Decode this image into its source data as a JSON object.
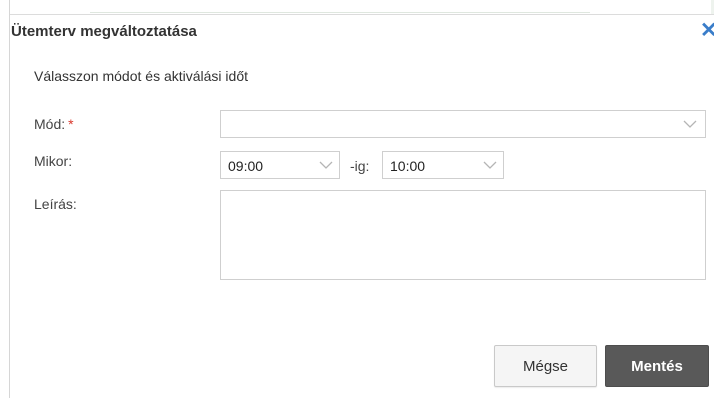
{
  "dialog": {
    "title": "Ütemterv megváltoztatása",
    "instruction": "Válasszon módot és aktiválási időt"
  },
  "form": {
    "mode_label": "Mód:",
    "required_marker": "*",
    "mode_value": "",
    "when_label": "Mikor:",
    "from_value": "09:00",
    "until_label": "-ig:",
    "to_value": "10:00",
    "description_label": "Leírás:",
    "description_value": ""
  },
  "buttons": {
    "cancel_label": "Mégse",
    "save_label": "Mentés"
  },
  "icons": {
    "close": "close-icon",
    "dropdown": "chevron-down-icon"
  },
  "colors": {
    "accent": "#3a7dc9",
    "required": "#d9372b",
    "primary_button": "#595959"
  }
}
